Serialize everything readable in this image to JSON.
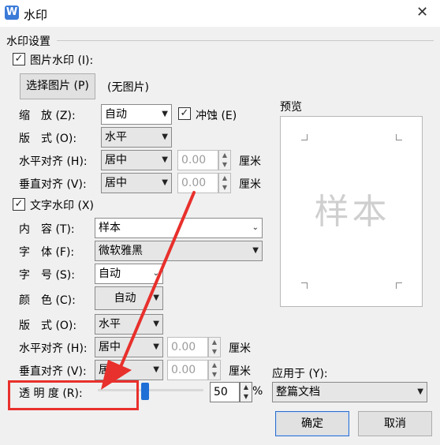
{
  "window": {
    "app_icon": "W",
    "title": "水印",
    "close": "✕"
  },
  "group_title": "水印设置",
  "picture_watermark": {
    "checkbox_label": "图片水印 (I):",
    "select_button": "选择图片 (P)",
    "no_image": "(无图片)",
    "scale_label": "缩　放 (Z):",
    "scale_value": "自动",
    "washout_label": "冲蚀 (E)",
    "layout_label": "版　式 (O):",
    "layout_value": "水平",
    "h_align_label": "水平对齐 (H):",
    "h_align_value": "居中",
    "h_offset": "0.00",
    "h_unit": "厘米",
    "v_align_label": "垂直对齐 (V):",
    "v_align_value": "居中",
    "v_offset": "0.00",
    "v_unit": "厘米"
  },
  "text_watermark": {
    "checkbox_label": "文字水印 (X)",
    "content_label": "内　容 (T):",
    "content_value": "样本",
    "font_label": "字　体 (F):",
    "font_value": "微软雅黑",
    "size_label": "字　号 (S):",
    "size_value": "自动",
    "color_label": "颜　色 (C):",
    "color_value": "自动",
    "layout_label": "版　式 (O):",
    "layout_value": "水平",
    "h_align_label": "水平对齐 (H):",
    "h_align_value": "居中",
    "h_offset": "0.00",
    "h_unit": "厘米",
    "v_align_label": "垂直对齐 (V):",
    "v_align_value": "居中",
    "v_offset": "0.00",
    "v_unit": "厘米",
    "transparency_label": "透 明 度 (R):",
    "transparency_value": "50",
    "transparency_unit": "%",
    "transparency_level": 0.5
  },
  "preview": {
    "label": "预览",
    "sample_text": "样本"
  },
  "apply_to": {
    "label": "应用于 (Y):",
    "value": "整篇文档"
  },
  "buttons": {
    "ok": "确定",
    "cancel": "取消"
  },
  "check_mark": "✓",
  "annotation_color": "#e8302c",
  "accent_color": "#1f6fd6"
}
